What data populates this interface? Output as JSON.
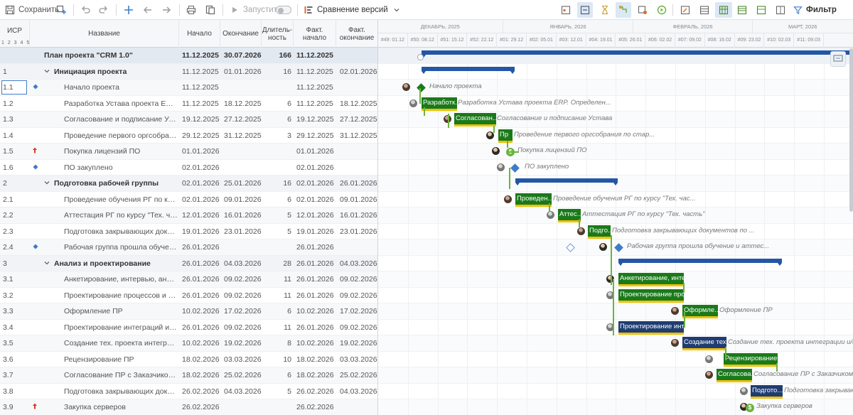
{
  "toolbar": {
    "save_label": "Сохранить",
    "run_label": "Запустить",
    "compare_label": "Сравнение версий",
    "filter_label": "Фильтр"
  },
  "columns": {
    "wbs": "ИСР",
    "levels": "1 2 3 4 5",
    "name": "Название",
    "start": "Начало",
    "end": "Окончание",
    "duration": "Длитель-\nность",
    "fact_start": "Факт. начало",
    "fact_end": "Факт.\nокончание"
  },
  "gantt_months": [
    "ДЕКАБРЬ, 2025",
    "ЯНВАРЬ, 2026",
    "ФЕВРАЛЬ, 2026",
    "МАРТ, 2026"
  ],
  "gantt_weeks": [
    "#49: 01.12",
    "#50: 08.12",
    "#51: 15.12",
    "#52: 22.12",
    "#01: 29.12",
    "#02: 05.01",
    "#03: 12.01",
    "#04: 19.01",
    "#05: 26.01",
    "#06: 02.02",
    "#07: 09.02",
    "#08: 16.02",
    "#09: 23.02",
    "#10: 02.03",
    "#11: 09.03"
  ],
  "rows": [
    {
      "wbs": "",
      "name": "План проекта \"CRM 1.0\"",
      "start": "11.12.2025",
      "end": "30.07.2026",
      "dur": "166",
      "fstart": "11.12.2025",
      "fend": "",
      "type": "proj"
    },
    {
      "wbs": "1",
      "name": "Инициация проекта",
      "start": "11.12.2025",
      "end": "01.01.2026",
      "dur": "16",
      "fstart": "11.12.2025",
      "fend": "02.01.2026",
      "type": "group"
    },
    {
      "wbs": "1.1",
      "name": "Начало проекта",
      "start": "11.12.2025",
      "end": "",
      "dur": "",
      "fstart": "11.12.2025",
      "fend": "",
      "type": "milestone"
    },
    {
      "wbs": "1.2",
      "name": "Разработка Устава проекта ERP. Оп...",
      "start": "11.12.2025",
      "end": "18.12.2025",
      "dur": "6",
      "fstart": "11.12.2025",
      "fend": "18.12.2025",
      "type": "task"
    },
    {
      "wbs": "1.3",
      "name": "Согласование и подписание Устава",
      "start": "19.12.2025",
      "end": "27.12.2025",
      "dur": "6",
      "fstart": "19.12.2025",
      "fend": "27.12.2025",
      "type": "task"
    },
    {
      "wbs": "1.4",
      "name": "Проведение первого оргсобрания ...",
      "start": "29.12.2025",
      "end": "31.12.2025",
      "dur": "3",
      "fstart": "29.12.2025",
      "fend": "31.12.2025",
      "type": "task"
    },
    {
      "wbs": "1.5",
      "name": "Покупка лицензий ПО",
      "start": "01.01.2026",
      "end": "",
      "dur": "",
      "fstart": "01.01.2026",
      "fend": "",
      "type": "purchase"
    },
    {
      "wbs": "1.6",
      "name": "ПО закуплено",
      "start": "02.01.2026",
      "end": "",
      "dur": "",
      "fstart": "02.01.2026",
      "fend": "",
      "type": "milestone"
    },
    {
      "wbs": "2",
      "name": "Подготовка рабочей группы",
      "start": "02.01.2026",
      "end": "25.01.2026",
      "dur": "16",
      "fstart": "02.01.2026",
      "fend": "26.01.2026",
      "type": "group"
    },
    {
      "wbs": "2.1",
      "name": "Проведение обучения РГ по курсу \"...",
      "start": "02.01.2026",
      "end": "09.01.2026",
      "dur": "6",
      "fstart": "02.01.2026",
      "fend": "09.01.2026",
      "type": "task"
    },
    {
      "wbs": "2.2",
      "name": "Аттестация РГ по курсу \"Тех. часть\"",
      "start": "12.01.2026",
      "end": "16.01.2026",
      "dur": "5",
      "fstart": "12.01.2026",
      "fend": "16.01.2026",
      "type": "task"
    },
    {
      "wbs": "2.3",
      "name": "Подготовка закрывающих докумен...",
      "start": "19.01.2026",
      "end": "23.01.2026",
      "dur": "5",
      "fstart": "19.01.2026",
      "fend": "23.01.2026",
      "type": "task"
    },
    {
      "wbs": "2.4",
      "name": "Рабочая группа прошла обучение ...",
      "start": "26.01.2026",
      "end": "",
      "dur": "",
      "fstart": "26.01.2026",
      "fend": "",
      "type": "milestone"
    },
    {
      "wbs": "3",
      "name": "Анализ и проектирование",
      "start": "26.01.2026",
      "end": "04.03.2026",
      "dur": "28",
      "fstart": "26.01.2026",
      "fend": "04.03.2026",
      "type": "group"
    },
    {
      "wbs": "3.1",
      "name": "Анкетирование, интервью, анализ",
      "start": "26.01.2026",
      "end": "09.02.2026",
      "dur": "11",
      "fstart": "26.01.2026",
      "fend": "09.02.2026",
      "type": "task"
    },
    {
      "wbs": "3.2",
      "name": "Проектирование процессов и наст...",
      "start": "26.01.2026",
      "end": "09.02.2026",
      "dur": "11",
      "fstart": "26.01.2026",
      "fend": "09.02.2026",
      "type": "task"
    },
    {
      "wbs": "3.3",
      "name": "Оформление ПР",
      "start": "10.02.2026",
      "end": "17.02.2026",
      "dur": "6",
      "fstart": "10.02.2026",
      "fend": "17.02.2026",
      "type": "task"
    },
    {
      "wbs": "3.4",
      "name": "Проектирование интеграций и миг...",
      "start": "26.01.2026",
      "end": "09.02.2026",
      "dur": "11",
      "fstart": "26.01.2026",
      "fend": "09.02.2026",
      "type": "task"
    },
    {
      "wbs": "3.5",
      "name": "Создание тех. проекта интеграции ...",
      "start": "10.02.2026",
      "end": "19.02.2026",
      "dur": "8",
      "fstart": "10.02.2026",
      "fend": "19.02.2026",
      "type": "task"
    },
    {
      "wbs": "3.6",
      "name": "Рецензирование ПР",
      "start": "18.02.2026",
      "end": "03.03.2026",
      "dur": "10",
      "fstart": "18.02.2026",
      "fend": "03.03.2026",
      "type": "task"
    },
    {
      "wbs": "3.7",
      "name": "Согласование ПР с Заказчиком и д...",
      "start": "18.02.2026",
      "end": "25.02.2026",
      "dur": "6",
      "fstart": "18.02.2026",
      "fend": "25.02.2026",
      "type": "task"
    },
    {
      "wbs": "3.8",
      "name": "Подготовка закрывающих докумен...",
      "start": "26.02.2026",
      "end": "04.03.2026",
      "dur": "5",
      "fstart": "26.02.2026",
      "fend": "04.03.2026",
      "type": "task"
    },
    {
      "wbs": "3.9",
      "name": "Закупка серверов",
      "start": "26.02.2026",
      "end": "",
      "dur": "",
      "fstart": "26.02.2026",
      "fend": "",
      "type": "purchase"
    }
  ],
  "gantt_bars": [
    {
      "label": "Разработк...",
      "color": "green"
    },
    {
      "label": "Согласован...",
      "color": "green"
    },
    {
      "label": "Пр",
      "color": "green"
    },
    {
      "label": "Проведен...",
      "color": "green"
    },
    {
      "label": "Аттес...",
      "color": "green"
    },
    {
      "label": "Подго...",
      "color": "green"
    },
    {
      "label": "Анкетирование, инте...",
      "color": "green"
    },
    {
      "label": "Проектирование про...",
      "color": "green"
    },
    {
      "label": "Оформле...",
      "color": "green"
    },
    {
      "label": "Проектирование инт...",
      "color": "blue"
    },
    {
      "label": "Создание тех...",
      "color": "blue"
    },
    {
      "label": "Рецензирование ПР",
      "color": "green"
    },
    {
      "label": "Согласова...",
      "color": "green"
    },
    {
      "label": "Подгото...",
      "color": "blue"
    }
  ],
  "gantt_labels": [
    "Начало проекта",
    "Разработка Устава проекта ERP. Определен...",
    "Согласование и подписание Устава",
    "Проведение первого оргсобрания по стар...",
    "Покупка лицензий ПО",
    "ПО закуплено",
    "Проведение обучения РГ по курсу \"Тех. час...",
    "Аттестация РГ по курсу \"Тех. часть\"",
    "Подготовка закрывающих документов по ...",
    "Рабочая группа прошла обучение и аттес...",
    "Оформление ПР",
    "Создание тех. проекта интеграции и/или...",
    "Согласование ПР с Заказчиком и д...",
    "Подготовка закрываю...",
    "Закупка серверов"
  ],
  "colors": {
    "task_green": "#1a7a1a",
    "task_blue": "#1f3d72",
    "summary": "#2456a6",
    "progress": "#f2c200",
    "connector": "#6cb33f"
  }
}
